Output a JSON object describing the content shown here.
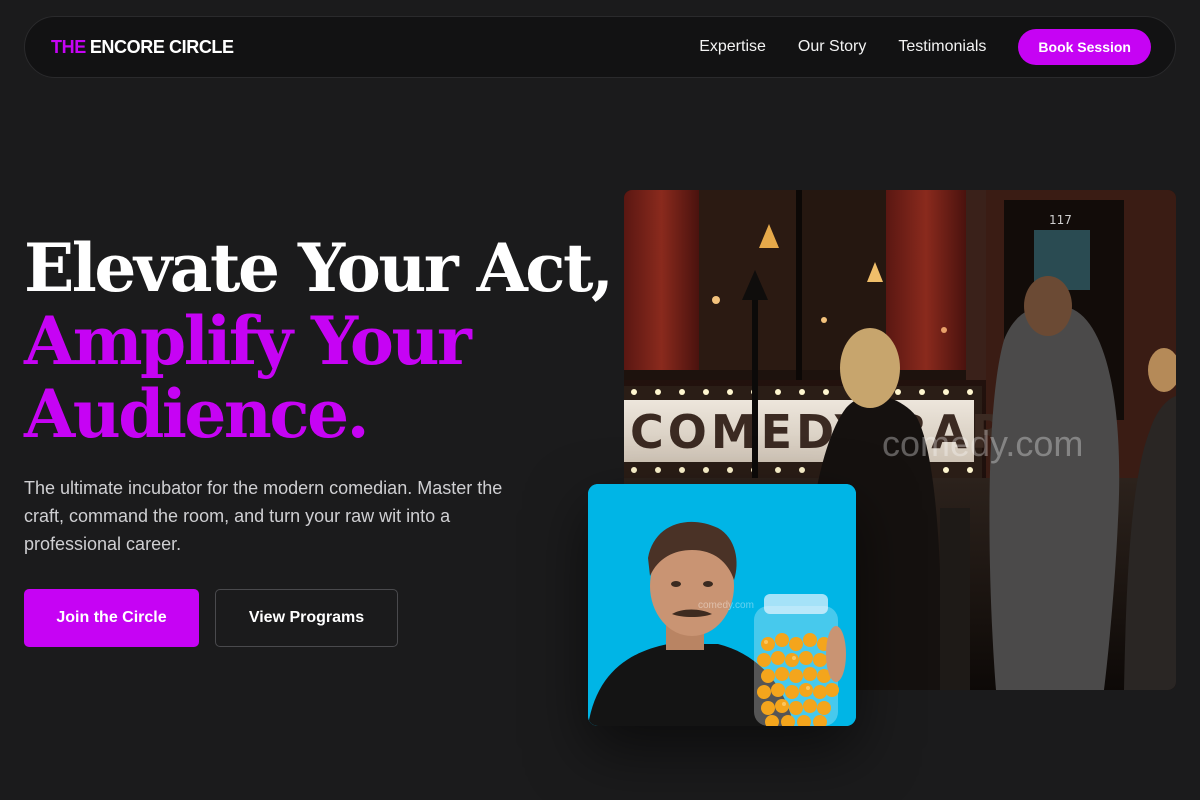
{
  "brand": {
    "accent": "THE",
    "rest": "ENCORE CIRCLE",
    "accent_color": "#c603f4"
  },
  "nav": {
    "links": [
      "Expertise",
      "Our Story",
      "Testimonials"
    ],
    "cta": "Book Session"
  },
  "hero": {
    "title_line1": "Elevate Your Act,",
    "title_line2": "Amplify Your",
    "title_line3": "Audience.",
    "subtitle": "The ultimate incubator for the modern comedian. Master the craft, command the room, and turn your raw wit into a professional career.",
    "primary_cta": "Join the Circle",
    "secondary_cta": "View Programs"
  },
  "images": {
    "main": {
      "sign_text": "COMEDY BAR",
      "door_number": "117",
      "watermark": "comedy.com"
    },
    "small": {
      "watermark": "comedy.com"
    }
  },
  "icons": [
    "comedy-club-photo",
    "comedian-portrait-photo"
  ]
}
